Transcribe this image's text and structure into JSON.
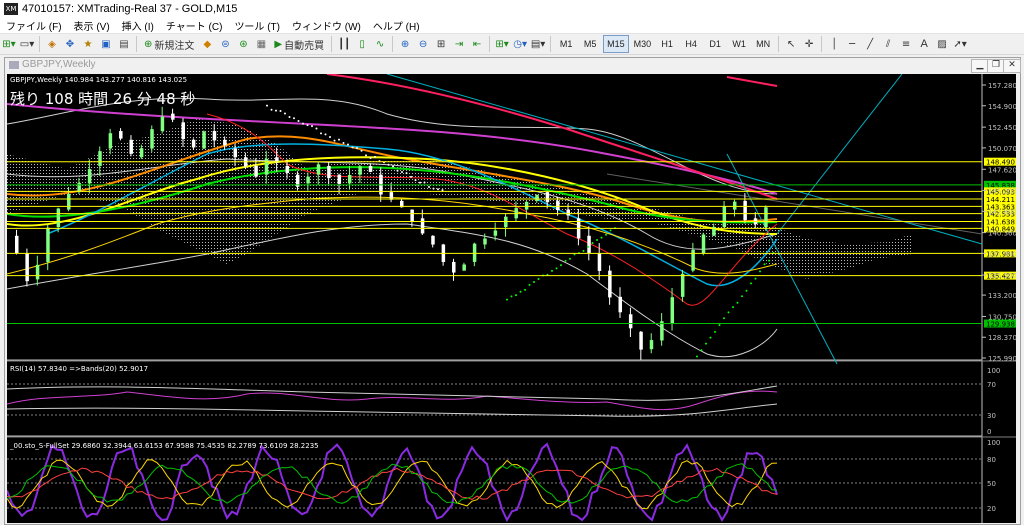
{
  "window": {
    "title": "47010157: XMTrading-Real 37 - GOLD,M15"
  },
  "menu": [
    "ファイル (F)",
    "表示 (V)",
    "挿入 (I)",
    "チャート (C)",
    "ツール (T)",
    "ウィンドウ (W)",
    "ヘルプ (H)"
  ],
  "toolbar": {
    "new_order_label": "新規注文",
    "auto_trade_label": "自動売買",
    "timeframes": [
      "M1",
      "M5",
      "M15",
      "M30",
      "H1",
      "H4",
      "D1",
      "W1",
      "MN"
    ],
    "active_timeframe": "M15"
  },
  "subwindow": {
    "title": "GBPJPY,Weekly"
  },
  "chart": {
    "symbol_info": "GBPJPY,Weekly  140.984 143.277 140.816 143.025",
    "countdown": "残り 108 時間 26 分 48 秒",
    "price_scale": [
      "157.280",
      "154.900",
      "152.450",
      "150.070",
      "147.620",
      "145.200",
      "142.800",
      "140.360",
      "137.990",
      "135.500",
      "133.200",
      "130.750",
      "128.370",
      "125.990"
    ],
    "levels": [
      {
        "value": "148.490",
        "color": "#ffff00"
      },
      {
        "value": "145.838",
        "color": "#00c000"
      },
      {
        "value": "145.093",
        "color": "#ffff00"
      },
      {
        "value": "144.211",
        "color": "#ffff00"
      },
      {
        "value": "143.363",
        "color": "#ffff00"
      },
      {
        "value": "142.533",
        "color": "#ffff00"
      },
      {
        "value": "141.638",
        "color": "#ffff00"
      },
      {
        "value": "140.849",
        "color": "#ffff00"
      },
      {
        "value": "137.981",
        "color": "#ffff00"
      },
      {
        "value": "135.427",
        "color": "#ffff00"
      },
      {
        "value": "129.938",
        "color": "#00c000"
      }
    ]
  },
  "rsi": {
    "label": "RSI(14) 57.8340  =>Bands(20) 52.9017",
    "scale": [
      "100",
      "70",
      "30",
      "0"
    ]
  },
  "stoch": {
    "label": "_00.sto_S-FullSet 29.6860 32.3944 63.6153 67.9588 75.4535 82.2789 73.6109 28.2235",
    "scale": [
      "100",
      "80",
      "50",
      "20"
    ]
  }
}
